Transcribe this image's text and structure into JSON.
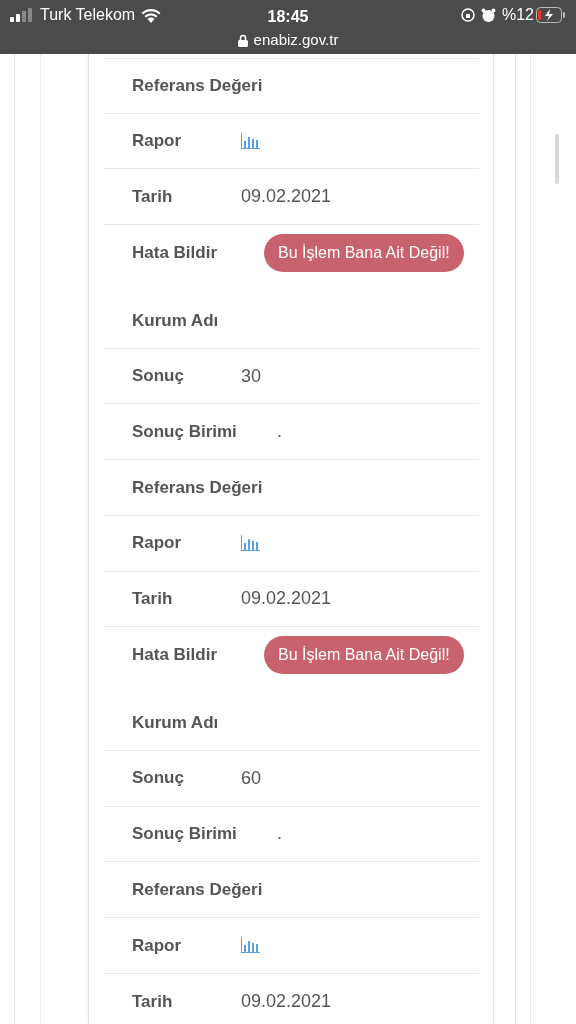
{
  "status_bar": {
    "carrier": "Turk Telekom",
    "time": "18:45",
    "battery": "%12",
    "url": "enabiz.gov.tr"
  },
  "records": [
    {
      "rows": [
        {
          "kind": "text",
          "label": "Referans Değeri"
        },
        {
          "kind": "report",
          "label": "Rapor"
        },
        {
          "kind": "text",
          "label": "Tarih",
          "value": "09.02.2021"
        },
        {
          "kind": "button",
          "label": "Hata Bildir",
          "value": "Bu İşlem Bana Ait Değil!"
        }
      ]
    },
    {
      "rows": [
        {
          "kind": "text",
          "label": "Kurum Adı"
        },
        {
          "kind": "text",
          "label": "Sonuç",
          "value": "30"
        },
        {
          "kind": "text",
          "label": "Sonuç Birimi",
          "value": "."
        },
        {
          "kind": "text",
          "label": "Referans Değeri"
        },
        {
          "kind": "report",
          "label": "Rapor"
        },
        {
          "kind": "text",
          "label": "Tarih",
          "value": "09.02.2021"
        },
        {
          "kind": "button",
          "label": "Hata Bildir",
          "value": "Bu İşlem Bana Ait Değil!"
        }
      ]
    },
    {
      "rows": [
        {
          "kind": "text",
          "label": "Kurum Adı"
        },
        {
          "kind": "text",
          "label": "Sonuç",
          "value": "60"
        },
        {
          "kind": "text",
          "label": "Sonuç Birimi",
          "value": "."
        },
        {
          "kind": "text",
          "label": "Referans Değeri"
        },
        {
          "kind": "report",
          "label": "Rapor"
        },
        {
          "kind": "text",
          "label": "Tarih",
          "value": "09.02.2021"
        }
      ]
    }
  ]
}
